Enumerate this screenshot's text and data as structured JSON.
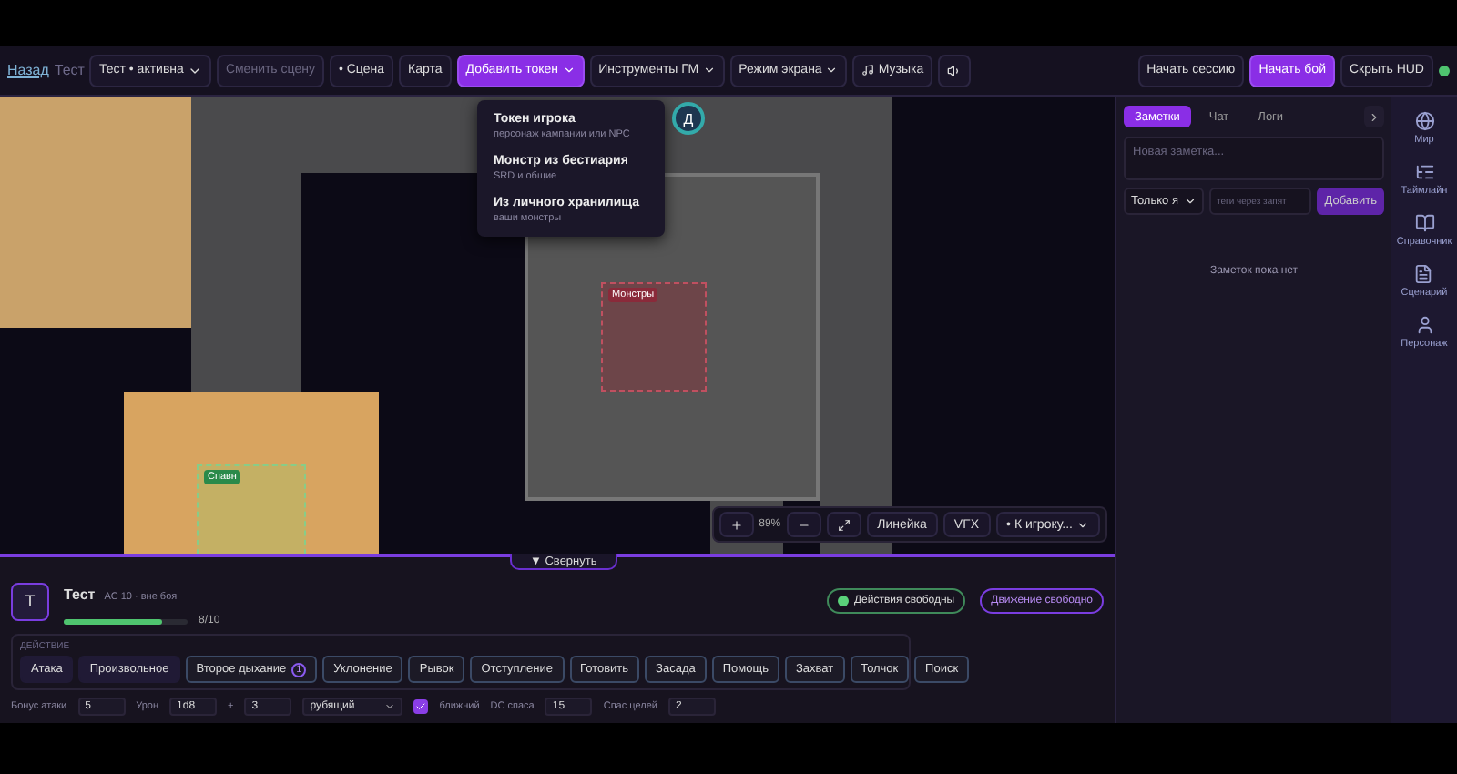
{
  "topbar": {
    "back": "Назад",
    "title": "Тест",
    "scene_select": "Тест • активна",
    "left_buttons": [
      {
        "label": "Сменить сцену",
        "disabled": true
      },
      {
        "label": "• Сцена",
        "disabled": false
      }
    ],
    "tabs": [
      {
        "label": "Карта",
        "selected": false,
        "menu": false
      },
      {
        "label": "Добавить токен",
        "selected": true,
        "menu": true
      },
      {
        "label": "Инструменты ГМ",
        "selected": false,
        "menu": true
      },
      {
        "label": "Режим экрана",
        "selected": false,
        "menu": true
      }
    ],
    "music": "Музыка",
    "right_buttons": [
      {
        "label": "Начать сессию",
        "primary": false
      },
      {
        "label": "Начать бой",
        "primary": true
      },
      {
        "label": "Скрыть HUD",
        "primary": false
      }
    ],
    "online": true
  },
  "dropdown": [
    {
      "title": "Токен игрока",
      "subtitle": "персонаж кампании или NPC"
    },
    {
      "title": "Монстр из бестиария",
      "subtitle": "SRD и общие"
    },
    {
      "title": "Из личного хранилища",
      "subtitle": "ваши монстры"
    }
  ],
  "map": {
    "zones": [
      {
        "label": "Монстры",
        "kind": "monster"
      },
      {
        "label": "Спавн",
        "kind": "spawn"
      }
    ],
    "token": "Д",
    "toolbar": {
      "zoom": "89%",
      "buttons": [
        "Линейка",
        "VFX"
      ],
      "follow_select": "• К игроку..."
    }
  },
  "hud": {
    "collapse": "▼ Свернуть",
    "character": {
      "avatar": "Т",
      "name": "Тест",
      "meta": "AC 10 · вне боя",
      "hp": "8/10",
      "level": 0.8
    },
    "badges": [
      {
        "label": "Действия свободны",
        "kind": "action"
      },
      {
        "label": "Движение свободно",
        "kind": "movement"
      }
    ],
    "section": "ДЕЙСТВИЕ",
    "actions": [
      {
        "label": "Атака",
        "kind": "basic"
      },
      {
        "label": "Произвольное",
        "kind": "basic"
      },
      {
        "label": "Второе дыхание",
        "kind": "standard",
        "count": "1"
      },
      {
        "label": "Уклонение",
        "kind": "standard"
      },
      {
        "label": "Рывок",
        "kind": "standard"
      },
      {
        "label": "Отступление",
        "kind": "standard"
      },
      {
        "label": "Готовить",
        "kind": "standard"
      },
      {
        "label": "Засада",
        "kind": "standard"
      },
      {
        "label": "Помощь",
        "kind": "standard"
      },
      {
        "label": "Захват",
        "kind": "standard"
      },
      {
        "label": "Толчок",
        "kind": "standard"
      },
      {
        "label": "Поиск",
        "kind": "standard"
      }
    ],
    "form": [
      {
        "kind": "field",
        "label": "Бонус атаки",
        "value": "5"
      },
      {
        "kind": "field",
        "label": "Урон",
        "value": "1d8"
      },
      {
        "kind": "field",
        "label": "+",
        "value": "3"
      },
      {
        "kind": "select",
        "value": "рубящий"
      },
      {
        "kind": "checkbox",
        "label": "ближний",
        "checked": true
      },
      {
        "kind": "field",
        "label": "DC спаса",
        "value": "15"
      },
      {
        "kind": "field",
        "label": "Спас целей",
        "value": "2"
      }
    ]
  },
  "notes": {
    "tabs": [
      {
        "label": "Заметки",
        "selected": true
      },
      {
        "label": "Чат",
        "selected": false
      },
      {
        "label": "Логи",
        "selected": false
      }
    ],
    "placeholder": "Новая заметка...",
    "visibility": "Только я",
    "tags_placeholder": "теги через запят",
    "add": "Добавить",
    "empty": "Заметок пока нет"
  },
  "sidebar": [
    {
      "label": "Мир",
      "kind": "globe"
    },
    {
      "label": "Таймлайн",
      "kind": "timeline"
    },
    {
      "label": "Справочник",
      "kind": "book"
    },
    {
      "label": "Сценарий",
      "kind": "script"
    },
    {
      "label": "Персонаж",
      "kind": "person"
    }
  ]
}
